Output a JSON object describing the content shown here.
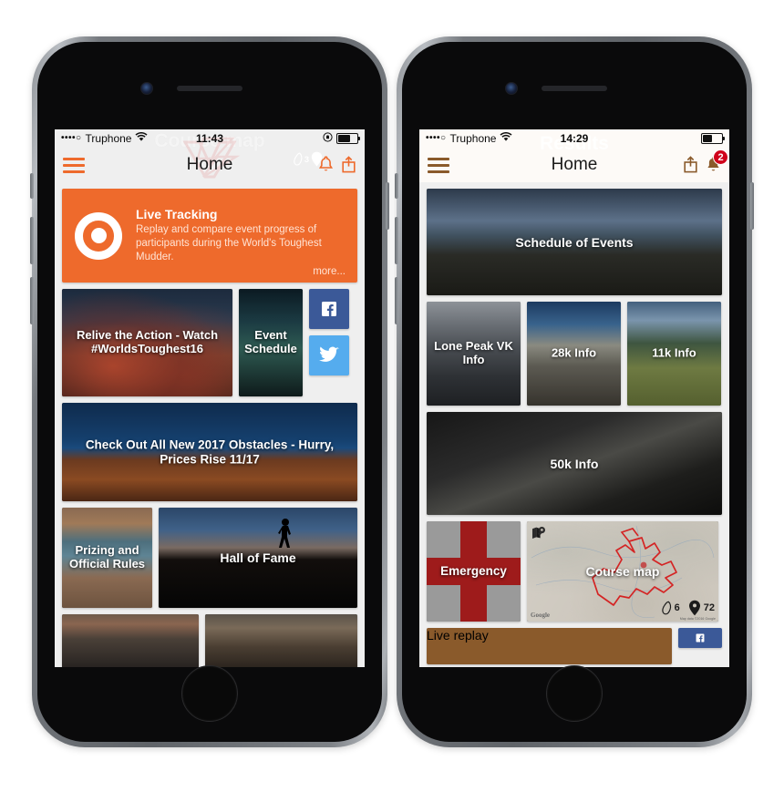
{
  "phones": [
    {
      "id": "left",
      "watermark": "Course map",
      "watermark_icons": {
        "footprint_count": "3"
      },
      "status_bar": {
        "signal_dots": "••••○",
        "carrier": "Truphone",
        "wifi_icon": "wifi-icon",
        "time": "11:43",
        "lock_icon": "rotation-lock-icon",
        "battery_icon": "battery-icon",
        "battery_level_pct": 70
      },
      "nav_bar": {
        "menu_icon": "hamburger-menu-icon",
        "title": "Home",
        "accent_color": "#ee6a2c",
        "icons": [
          {
            "name": "bell-icon",
            "badge": null
          },
          {
            "name": "share-icon",
            "badge": null
          }
        ]
      },
      "banner": {
        "icon": "live-tracking-ring-icon",
        "title": "Live Tracking",
        "description": "Replay and compare event progress of participants during the World's Toughest Mudder.",
        "more_label": "more...",
        "background_color": "#ee6a2c"
      },
      "tiles": [
        {
          "label": "Relive the Action - Watch #WorldsToughest16",
          "photo": "smoke"
        },
        {
          "label": "Event Schedule",
          "photo": "darkpanel"
        },
        {
          "label": "Check Out All New 2017 Obstacles - Hurry, Prices Rise 11/17",
          "photo": "obst"
        },
        {
          "label": "Prizing and Official Rules",
          "photo": "canyon"
        },
        {
          "label": "Hall of Fame",
          "photo": "hill"
        },
        {
          "label": "",
          "photo": "crowd"
        },
        {
          "label": "",
          "photo": "mud"
        }
      ],
      "social": [
        {
          "name": "facebook-button",
          "glyph": "f",
          "color": "#3b5998"
        },
        {
          "name": "twitter-button",
          "glyph": "twitter-bird",
          "color": "#55acee"
        }
      ]
    },
    {
      "id": "right",
      "watermark": "Results",
      "status_bar": {
        "signal_dots": "••••○",
        "carrier": "Truphone",
        "wifi_icon": "wifi-icon",
        "time": "14:29",
        "lock_icon": null,
        "battery_icon": "battery-icon",
        "battery_level_pct": 55
      },
      "nav_bar": {
        "menu_icon": "hamburger-menu-icon",
        "title": "Home",
        "accent_color": "#8a5a2b",
        "icons": [
          {
            "name": "share-icon",
            "badge": null
          },
          {
            "name": "bell-icon",
            "badge": "2"
          }
        ]
      },
      "tiles": [
        {
          "label": "Schedule of Events",
          "photo": "mountains"
        },
        {
          "label": "Lone Peak VK Info",
          "photo": "lonepeak"
        },
        {
          "label": "28k Info",
          "photo": "k28"
        },
        {
          "label": "11k Info",
          "photo": "k11"
        },
        {
          "label": "50k Info",
          "photo": "k50"
        },
        {
          "label": "Emergency",
          "photo": "emerg"
        },
        {
          "label": "Course map",
          "photo": "coursemap"
        },
        {
          "label": "Live replay",
          "photo": "replay"
        }
      ],
      "course_map": {
        "map_icon": "map-pin-icon",
        "footprint_icon": "footprint-icon",
        "footprint_count": "6",
        "pin_icon": "location-pin-icon",
        "pin_count": "72",
        "attribution": "Map data ©2016 Google",
        "provider_logo": "Google"
      },
      "social": [
        {
          "name": "facebook-button",
          "glyph": "f",
          "color": "#3b5998"
        }
      ]
    }
  ]
}
